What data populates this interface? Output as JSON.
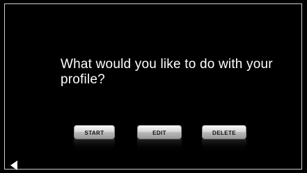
{
  "screen": {
    "prompt": "What would you like to do with your profile?"
  },
  "actions": {
    "start_label": "START",
    "edit_label": "EDIT",
    "delete_label": "DELETE"
  },
  "navigation": {
    "back_icon": "back-icon"
  },
  "colors": {
    "background": "#000000",
    "text": "#ffffff",
    "button_top": "#f7f7f7",
    "button_bottom": "#9d9d9d"
  }
}
